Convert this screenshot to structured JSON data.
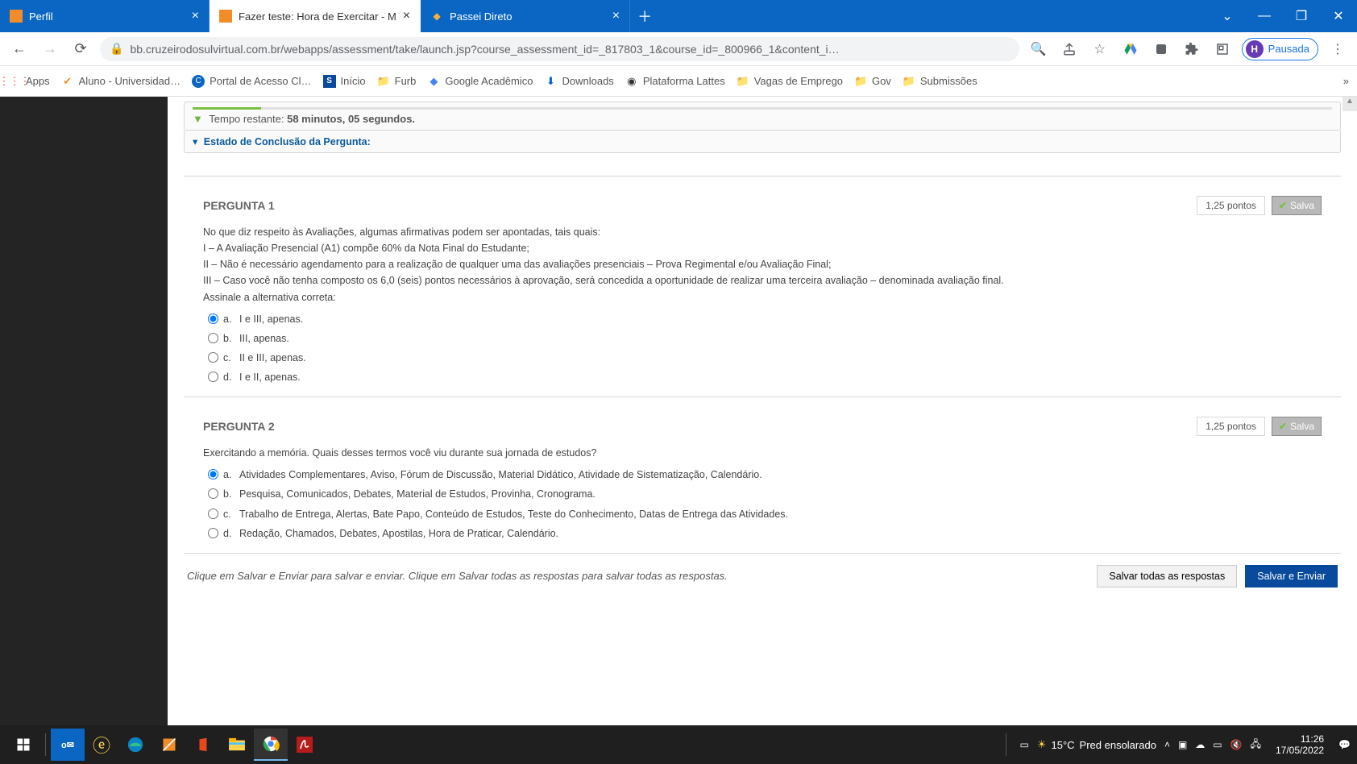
{
  "browser": {
    "tabs": [
      {
        "label": "Perfil",
        "closeable": true
      },
      {
        "label": "Fazer teste: Hora de Exercitar - M",
        "closeable": true,
        "active": true
      },
      {
        "label": "Passei Direto",
        "closeable": true
      }
    ],
    "url_display": "bb.cruzeirodosulvirtual.com.br/webapps/assessment/take/launch.jsp?course_assessment_id=_817803_1&course_id=_800966_1&content_i…",
    "profile_status": "Pausada",
    "profile_initial": "H",
    "bookmarks": [
      {
        "label": "Apps"
      },
      {
        "label": "Aluno - Universidad…"
      },
      {
        "label": "Portal de Acesso Cl…"
      },
      {
        "label": "Início"
      },
      {
        "label": "Furb"
      },
      {
        "label": "Google Acadêmico"
      },
      {
        "label": "Downloads"
      },
      {
        "label": "Plataforma Lattes"
      },
      {
        "label": "Vagas de Emprego"
      },
      {
        "label": "Gov"
      },
      {
        "label": "Submissões"
      }
    ]
  },
  "quiz": {
    "timer_label": "Tempo restante: ",
    "timer_minutes": "58 minutos, ",
    "timer_seconds": "05 segundos.",
    "estado_label": "Estado de Conclusão da Pergunta:",
    "questions": [
      {
        "title": "PERGUNTA 1",
        "points_text": "1,25 pontos",
        "saved_label": "Salva",
        "stem": "No que diz respeito às Avaliações, algumas afirmativas podem ser apontadas, tais quais:",
        "lines": [
          "I – A Avaliação Presencial (A1) compõe 60% da Nota Final do Estudante;",
          "II – Não é necessário agendamento para a realização de qualquer uma das avaliações presenciais – Prova Regimental e/ou Avaliação Final;",
          "III – Caso você não tenha composto os 6,0 (seis) pontos necessários à aprovação, será concedida a oportunidade de realizar uma terceira avaliação – denominada avaliação final.",
          "Assinale a alternativa correta:"
        ],
        "options": [
          {
            "letter": "a.",
            "text": "I e III, apenas.",
            "selected": true
          },
          {
            "letter": "b.",
            "text": "III, apenas.",
            "selected": false
          },
          {
            "letter": "c.",
            "text": "II e III, apenas.",
            "selected": false
          },
          {
            "letter": "d.",
            "text": "I e II, apenas.",
            "selected": false
          }
        ]
      },
      {
        "title": "PERGUNTA 2",
        "points_text": "1,25 pontos",
        "saved_label": "Salva",
        "stem": "Exercitando a memória. Quais desses termos você viu durante sua jornada de estudos?",
        "lines": [],
        "options": [
          {
            "letter": "a.",
            "text": "Atividades Complementares, Aviso, Fórum de Discussão, Material Didático, Atividade de Sistematização, Calendário.",
            "selected": true
          },
          {
            "letter": "b.",
            "text": "Pesquisa, Comunicados, Debates, Material de Estudos, Provinha, Cronograma.",
            "selected": false
          },
          {
            "letter": "c.",
            "text": "Trabalho de Entrega, Alertas, Bate Papo, Conteúdo de Estudos, Teste do Conhecimento, Datas de Entrega das Atividades.",
            "selected": false
          },
          {
            "letter": "d.",
            "text": "Redação, Chamados, Debates, Apostilas, Hora de Praticar, Calendário.",
            "selected": false
          }
        ]
      }
    ],
    "submit_note": "Clique em Salvar e Enviar para salvar e enviar. Clique em Salvar todas as respostas para salvar todas as respostas.",
    "btn_save_all": "Salvar todas as respostas",
    "btn_submit": "Salvar e Enviar"
  },
  "taskbar": {
    "weather_temp": "15°C",
    "weather_desc": "Pred ensolarado",
    "time": "11:26",
    "date": "17/05/2022"
  }
}
